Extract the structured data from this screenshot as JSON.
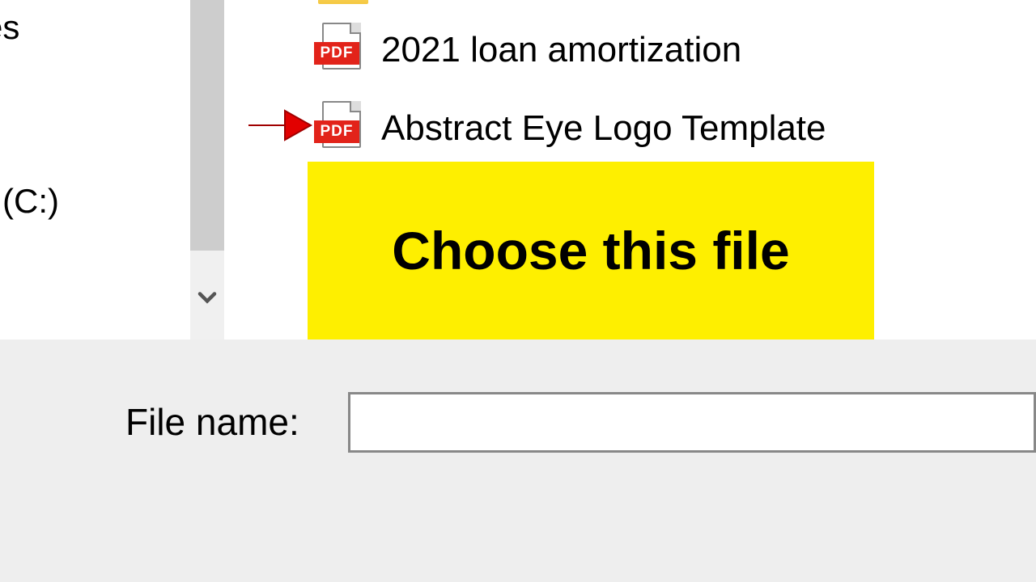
{
  "sidebar": {
    "item1": "es",
    "item2": "ws (C:)",
    "item3": "‹"
  },
  "files": [
    {
      "name": "2021 loan amortization",
      "type": "PDF"
    },
    {
      "name": "Abstract Eye Logo Template",
      "type": "PDF"
    }
  ],
  "pdf_badge": "PDF",
  "annotation": "Choose this file",
  "filename_label": "File name:",
  "filename_value": ""
}
